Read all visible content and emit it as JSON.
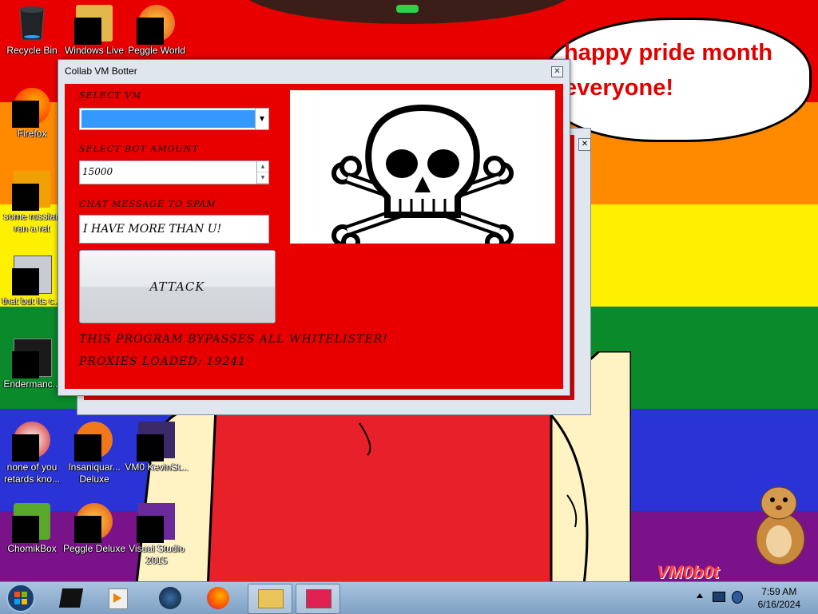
{
  "wallpaper": {
    "speech_text": "happy pride month\neveryone!",
    "watermark": "VM0b0t"
  },
  "desktop_icons": [
    {
      "label": "Recycle Bin",
      "icon": "recycle-bin-icon"
    },
    {
      "label": "Windows Live",
      "icon": "folder-icon"
    },
    {
      "label": "Peggle World",
      "icon": "peggle-icon"
    },
    {
      "label": "Firefox",
      "icon": "firefox-icon"
    },
    {
      "label": "some russian ran a rat",
      "icon": "app-icon"
    },
    {
      "label": "that but its c...",
      "icon": "app-icon"
    },
    {
      "label": "Endermanc...",
      "icon": "app-icon"
    },
    {
      "label": "none of you retards kno...",
      "icon": "app-icon"
    },
    {
      "label": "Insaniquar... Deluxe",
      "icon": "game-icon"
    },
    {
      "label": "VM0 KevinSt...",
      "icon": "app-icon"
    },
    {
      "label": "ChomikBox",
      "icon": "chomikbox-icon"
    },
    {
      "label": "Peggle Deluxe",
      "icon": "peggle-icon"
    },
    {
      "label": "Visual Studio 2015",
      "icon": "visual-studio-icon"
    }
  ],
  "window": {
    "title": "Collab VM Botter",
    "close_label": "✕",
    "select_vm_label": "SELECT VM",
    "select_vm_value": "",
    "bot_amount_label": "SELECT BOT AMOUNT",
    "bot_amount_value": "15000",
    "chat_message_label": "CHAT MESSAGE TO SPAM",
    "chat_message_value": "I HAVE MORE THAN U!",
    "attack_label": "ATTACK",
    "bypass_text": "THIS PROGRAM BYPASSES ALL WHITELISTER!",
    "proxies_text": "PROXIES LOADED: 19241"
  },
  "taskbar": {
    "time": "7:59 AM",
    "date": "6/16/2024"
  },
  "colors": {
    "window_client": "#e80000",
    "combo_selection": "#3399ff",
    "speech_text": "#e00000"
  }
}
